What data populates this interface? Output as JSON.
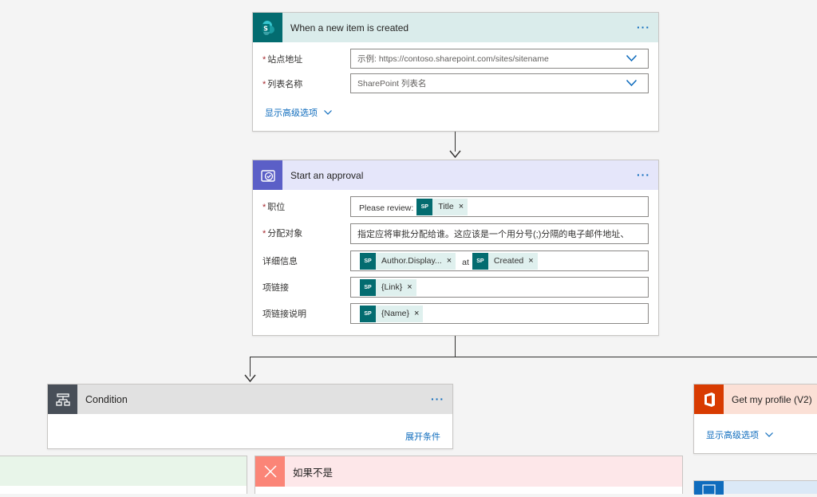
{
  "trigger": {
    "title": "When a new item is created",
    "menu": "···",
    "site_label": "站点地址",
    "site_placeholder": "示例: https://contoso.sharepoint.com/sites/sitename",
    "list_label": "列表名称",
    "list_placeholder": "SharePoint 列表名",
    "advanced_label": "显示高级选项"
  },
  "approval": {
    "title": "Start an approval",
    "menu": "···",
    "title_label": "职位",
    "title_prefix": "Please review:",
    "title_token": "Title",
    "assign_label": "分配对象",
    "assign_placeholder": "指定应将审批分配给谁。这应该是一个用分号(;)分隔的电子邮件地址、",
    "details_label": "详细信息",
    "details_token1": "Author.Display...",
    "details_at": "at",
    "details_token2": "Created",
    "link_label": "项链接",
    "link_token": "{Link}",
    "linkdesc_label": "项链接说明",
    "linkdesc_token": "{Name}",
    "token_close": "×"
  },
  "condition": {
    "title": "Condition",
    "menu": "···",
    "expand_label": "展开条件"
  },
  "profile": {
    "title": "Get my profile (V2)",
    "advanced_label": "显示高级选项"
  },
  "ifno": {
    "title": "如果不是"
  },
  "colors": {
    "sharepoint": "#036c70",
    "approval": "#5b5fc7",
    "condition": "#484f58",
    "office": "#d83b01",
    "no_branch": "#fb8577",
    "link": "#0f6cbd"
  }
}
